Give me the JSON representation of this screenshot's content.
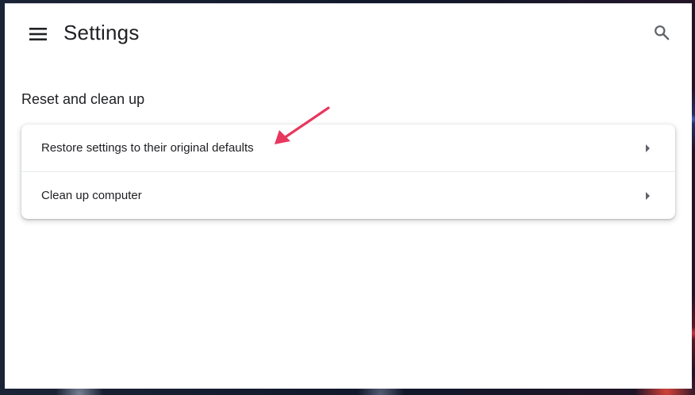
{
  "header": {
    "title": "Settings",
    "menu_icon": "hamburger-menu-icon",
    "search_icon": "search-icon"
  },
  "section": {
    "title": "Reset and clean up"
  },
  "items": [
    {
      "label": "Restore settings to their original defaults",
      "icon": "arrow-right-icon"
    },
    {
      "label": "Clean up computer",
      "icon": "arrow-right-icon"
    }
  ],
  "colors": {
    "text": "#202124",
    "icon": "#5f6368",
    "annotation": "#e8375e",
    "divider": "#e8eaed"
  }
}
